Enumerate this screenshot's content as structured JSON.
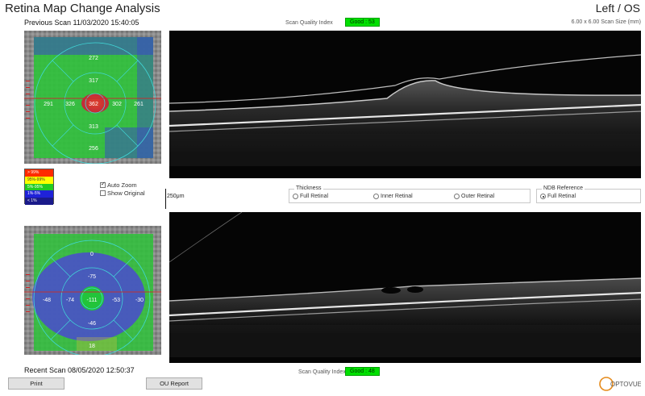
{
  "header": {
    "title": "Retina Map Change Analysis",
    "eye": "Left / OS",
    "scan_size": "6.00 x 6.00 Scan Size (mm)"
  },
  "previous_scan": {
    "caption": "Previous Scan 11/03/2020 15:40:05",
    "sqi_label": "Scan Quality Index",
    "sqi_value": "Good : 53",
    "values": {
      "superior_outer": "272",
      "superior_inner": "317",
      "temporal_outer": "291",
      "temporal_inner": "326",
      "center": "362",
      "nasal_inner": "302",
      "nasal_outer": "261",
      "inferior_inner": "313",
      "inferior_outer": "256"
    }
  },
  "recent_scan": {
    "caption": "Recent Scan 08/05/2020 12:50:37",
    "sqi_label": "Scan Quality Index",
    "sqi_value": "Good : 48",
    "values": {
      "superior_outer": "0",
      "superior_inner": "-75",
      "temporal_outer": "-48",
      "temporal_inner": "-74",
      "center": "-111",
      "nasal_inner": "-53",
      "nasal_outer": "-30",
      "inferior_inner": "-46",
      "inferior_outer": "18"
    }
  },
  "legend": [
    {
      "label": "> 99%",
      "color": "#ff2a00",
      "text_color": "#ffffff"
    },
    {
      "label": "95%-99%",
      "color": "#ffff00",
      "text_color": "#333333"
    },
    {
      "label": "5%-95%",
      "color": "#22cc22",
      "text_color": "#ffffff"
    },
    {
      "label": "1%-5%",
      "color": "#1f22d8",
      "text_color": "#ffffff"
    },
    {
      "label": "< 1%",
      "color": "#1a1a8a",
      "text_color": "#ffffff"
    }
  ],
  "options": {
    "auto_zoom": "Auto Zoom",
    "show_original": "Show Original"
  },
  "scale_label": "250μm",
  "thickness": {
    "title": "Thickness",
    "full": "Full Retinal",
    "inner": "Inner Retinal",
    "outer": "Outer Retinal"
  },
  "ndb": {
    "title": "NDB Reference",
    "full": "Full Retinal"
  },
  "buttons": {
    "print": "Print",
    "ou_report": "OU Report"
  },
  "logo_text": "OPTOVUE",
  "colors": {
    "sqi_good": "#00e000",
    "accent_red": "#d02020",
    "grid_cyan": "#40d8d8"
  }
}
